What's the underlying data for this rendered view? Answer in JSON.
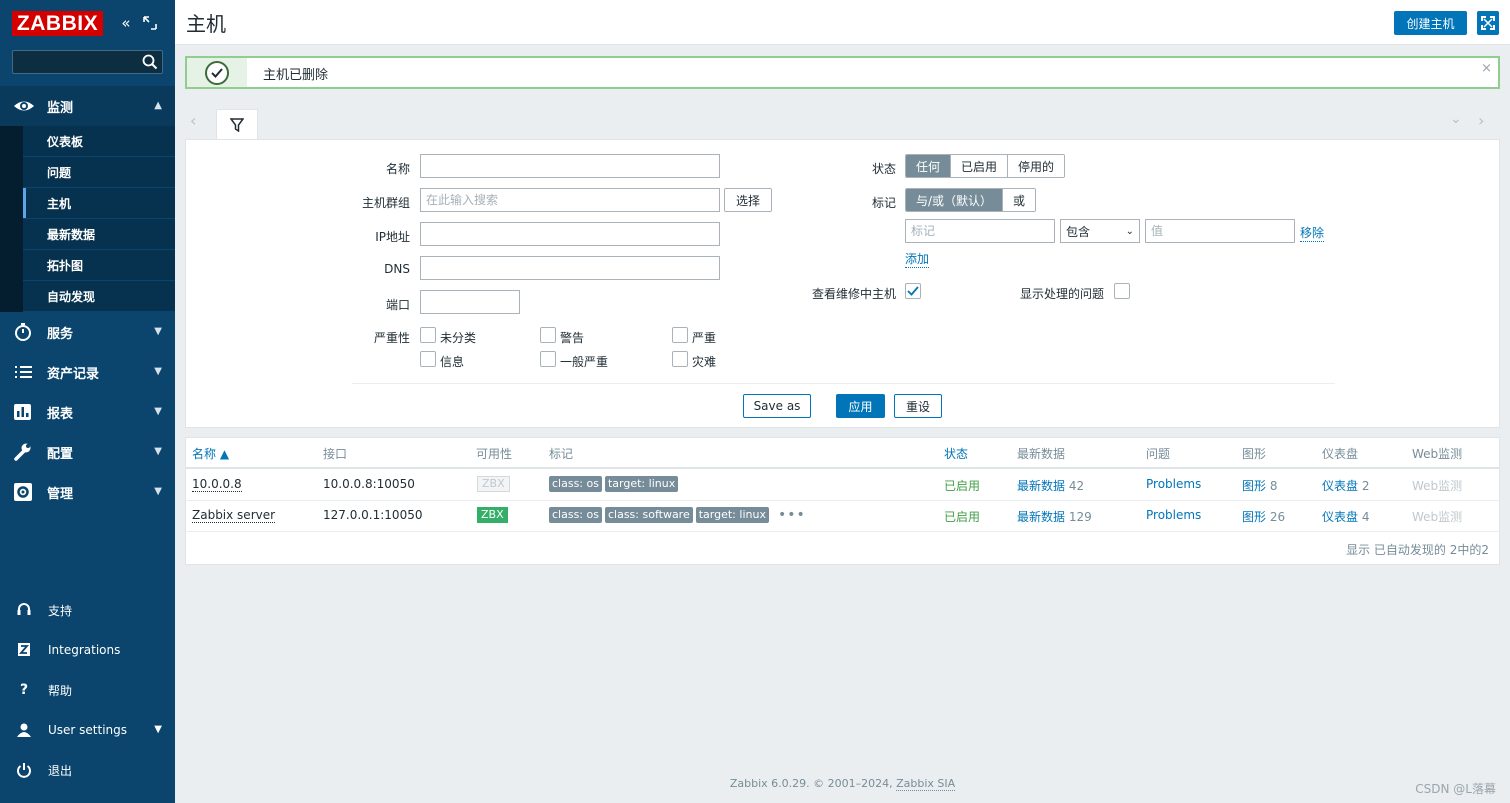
{
  "sidebar": {
    "logo": "ZABBIX",
    "search_placeholder": "",
    "menu": [
      {
        "label": "监测",
        "icon": "eye-icon"
      },
      {
        "label": "服务",
        "icon": "stopwatch-icon"
      },
      {
        "label": "资产记录",
        "icon": "list-icon"
      },
      {
        "label": "报表",
        "icon": "bar-chart-icon"
      },
      {
        "label": "配置",
        "icon": "wrench-icon"
      },
      {
        "label": "管理",
        "icon": "gear-icon"
      }
    ],
    "submenu": [
      "仪表板",
      "问题",
      "主机",
      "最新数据",
      "拓扑图",
      "自动发现"
    ],
    "bottom": [
      {
        "label": "支持",
        "icon": "headset-icon"
      },
      {
        "label": "Integrations",
        "icon": "zabbix-z-icon"
      },
      {
        "label": "帮助",
        "icon": "question-icon"
      },
      {
        "label": "User settings",
        "icon": "user-icon"
      },
      {
        "label": "退出",
        "icon": "power-icon"
      }
    ]
  },
  "header": {
    "title": "主机",
    "create_button": "创建主机"
  },
  "message": {
    "text": "主机已删除",
    "close": "×"
  },
  "filter": {
    "name_label": "名称",
    "name_value": "",
    "hostgroup_label": "主机群组",
    "hostgroup_placeholder": "在此输入搜索",
    "select_button": "选择",
    "ip_label": "IP地址",
    "dns_label": "DNS",
    "port_label": "端口",
    "severity_label": "严重性",
    "severities": [
      "未分类",
      "警告",
      "严重",
      "信息",
      "一般严重",
      "灾难"
    ],
    "status_label": "状态",
    "status_options": [
      "任何",
      "已启用",
      "停用的"
    ],
    "tags_label": "标记",
    "tag_ops": [
      "与/或（默认）",
      "或"
    ],
    "tag_placeholder": "标记",
    "tag_operator": "包含",
    "tag_value_placeholder": "值",
    "remove_link": "移除",
    "add_link": "添加",
    "maintenance_label": "查看维修中主机",
    "maintenance_checked": true,
    "suppressed_label": "显示处理的问题",
    "suppressed_checked": false,
    "save_as": "Save as",
    "apply": "应用",
    "reset": "重设"
  },
  "table": {
    "headers": [
      "名称 ▲",
      "接口",
      "可用性",
      "标记",
      "状态",
      "最新数据",
      "问题",
      "图形",
      "仪表盘",
      "Web监测"
    ],
    "rows": [
      {
        "name": "10.0.0.8",
        "interface": "10.0.0.8:10050",
        "availability": "ZBX",
        "tags": [
          "class: os",
          "target: linux"
        ],
        "status": "已启用",
        "latest": "最新数据",
        "latest_count": "42",
        "problems": "Problems",
        "graphs": "图形",
        "graphs_count": "8",
        "dashboards": "仪表盘",
        "dashboards_count": "2",
        "web": "Web监测"
      },
      {
        "name": "Zabbix server",
        "interface": "127.0.0.1:10050",
        "availability": "ZBX",
        "tags": [
          "class: os",
          "class: software",
          "target: linux"
        ],
        "more": "•••",
        "status": "已启用",
        "latest": "最新数据",
        "latest_count": "129",
        "problems": "Problems",
        "graphs": "图形",
        "graphs_count": "26",
        "dashboards": "仪表盘",
        "dashboards_count": "4",
        "web": "Web监测"
      }
    ],
    "footer": "显示 已自动发现的 2中的2"
  },
  "footer": {
    "text": "Zabbix 6.0.29. © 2001–2024,",
    "link": "Zabbix SIA"
  },
  "watermark": "CSDN @L落幕",
  "colors": {
    "sidebar": "#0b456d",
    "accent": "#0275b8",
    "logo": "#d40000",
    "enabled": "#429e47",
    "zbx_available": "#34af67"
  }
}
